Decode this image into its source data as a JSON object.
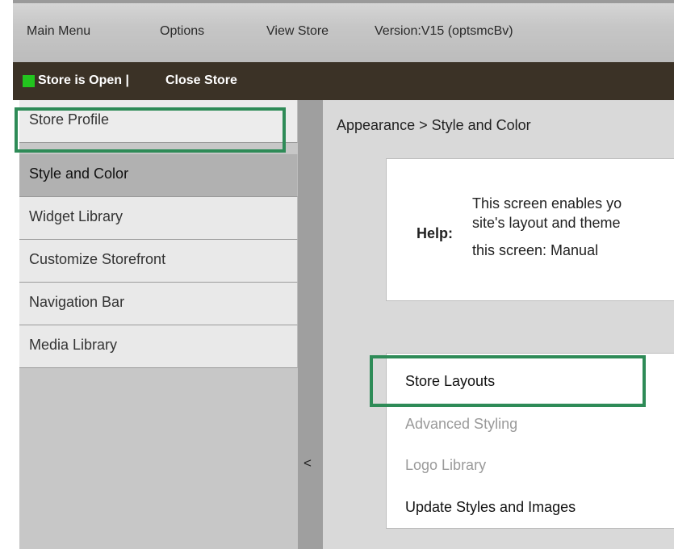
{
  "menubar": {
    "items": [
      "Main Menu",
      "Options",
      "View Store"
    ],
    "version": "Version:V15 (optsmcBv)"
  },
  "status": {
    "text": "Store is Open |",
    "action": "Close Store",
    "indicator_color": "#22c51e"
  },
  "sidebar": {
    "items": [
      {
        "label": "Store Profile"
      },
      {
        "label": "Style and Color"
      },
      {
        "label": "Widget Library"
      },
      {
        "label": "Customize Storefront"
      },
      {
        "label": "Navigation Bar"
      },
      {
        "label": "Media Library"
      }
    ],
    "active_item": "Style and Color"
  },
  "collapse": {
    "label": "<"
  },
  "main": {
    "breadcrumb": "Appearance > Style and Color",
    "help": {
      "label": "Help:",
      "lines": [
        "This screen enables yo",
        "site's layout and theme",
        "this screen: Manual"
      ]
    },
    "links": [
      {
        "label": "Store Layouts",
        "enabled": true
      },
      {
        "label": "Advanced Styling",
        "enabled": false
      },
      {
        "label": "Logo Library",
        "enabled": false
      },
      {
        "label": "Update Styles and Images",
        "enabled": true
      }
    ]
  },
  "highlight_color": "#2e8b57"
}
